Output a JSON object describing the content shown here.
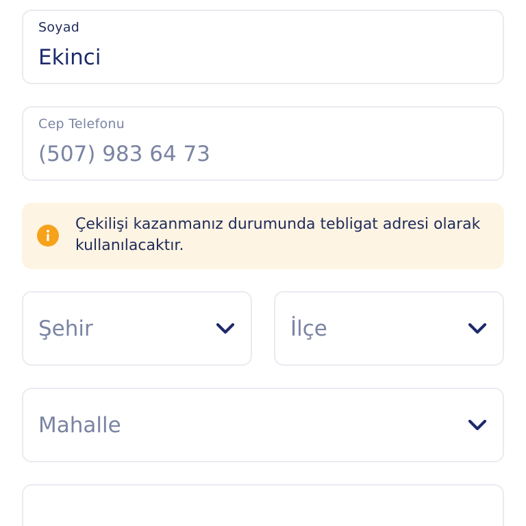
{
  "form": {
    "surname": {
      "label": "Soyad",
      "value": "Ekinci"
    },
    "phone": {
      "label": "Cep Telefonu",
      "placeholder": "(507) 983 64 73"
    },
    "notice": {
      "icon": "info-icon",
      "text": "Çekilişi kazanmanız durumunda tebligat adresi olarak kullanılacaktır."
    },
    "city": {
      "placeholder": "Şehir",
      "icon": "chevron-down-icon"
    },
    "district": {
      "placeholder": "İlçe",
      "icon": "chevron-down-icon"
    },
    "neighborhood": {
      "placeholder": "Mahalle",
      "icon": "chevron-down-icon"
    }
  },
  "colors": {
    "text_primary": "#1c2a6b",
    "text_muted": "#7a84a2",
    "border": "#e9ebf0",
    "notice_bg": "#fef4e3",
    "info_icon": "#f6a21a"
  }
}
